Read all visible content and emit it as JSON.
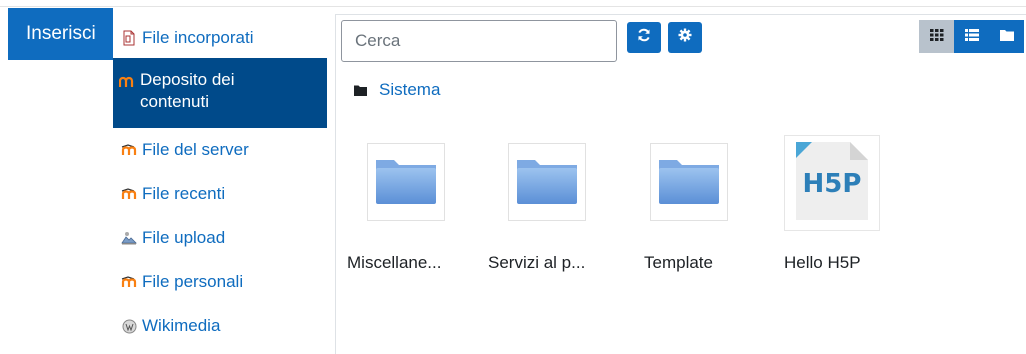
{
  "tab": {
    "label": "Inserisci"
  },
  "sidebar": {
    "items": [
      {
        "label": "File incorporati",
        "icon": "embedded-files-icon"
      },
      {
        "label": "Deposito dei contenuti",
        "line1": "Deposito dei",
        "line2": "contenuti",
        "icon": "content-bank-icon",
        "active": true
      },
      {
        "label": "File del server",
        "icon": "moodle-server-icon"
      },
      {
        "label": "File recenti",
        "icon": "moodle-recent-icon"
      },
      {
        "label": "File upload",
        "icon": "upload-icon"
      },
      {
        "label": "File personali",
        "icon": "moodle-private-icon"
      },
      {
        "label": "Wikimedia",
        "icon": "wikimedia-icon"
      }
    ]
  },
  "toolbar": {
    "search_placeholder": "Cerca",
    "refresh_icon": "refresh-icon",
    "settings_icon": "gear-icon",
    "views": [
      "grid-view-icon",
      "list-view-icon",
      "folder-view-icon"
    ],
    "selected_view": "grid-view-icon"
  },
  "breadcrumb": {
    "label": "Sistema",
    "icon": "folder-icon"
  },
  "files": [
    {
      "name": "Miscellane...",
      "type": "folder"
    },
    {
      "name": "Servizi al p...",
      "type": "folder"
    },
    {
      "name": "Template",
      "type": "folder"
    },
    {
      "name": "Hello H5P",
      "type": "h5p"
    }
  ],
  "colors": {
    "primary": "#0f6cbf",
    "active_item": "#004a8a",
    "selected_view": "#b8c2cc",
    "moodle_orange": "#f98012"
  }
}
